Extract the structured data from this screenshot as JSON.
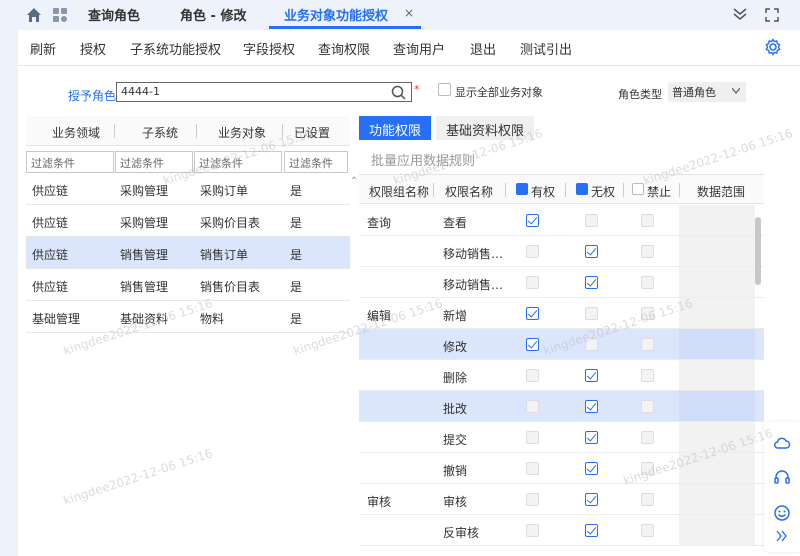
{
  "tabs": [
    {
      "label": "查询角色"
    },
    {
      "label": "角色 - 修改"
    },
    {
      "label": "业务对象功能授权",
      "close": "×"
    }
  ],
  "toolbar": [
    "刷新",
    "授权",
    "子系统功能授权",
    "字段授权",
    "查询权限",
    "查询用户",
    "退出",
    "测试引出"
  ],
  "form": {
    "role_label": "授予角色",
    "role_value": "4444-1",
    "required_mark": "*",
    "show_all_label": "显示全部业务对象",
    "role_type_label": "角色类型",
    "role_type_value": "普通角色"
  },
  "left_table": {
    "headers": [
      "业务领域",
      "子系统",
      "业务对象",
      "已设置"
    ],
    "filter_placeholder": "过滤条件",
    "rows": [
      [
        "供应链",
        "采购管理",
        "采购订单",
        "是"
      ],
      [
        "供应链",
        "采购管理",
        "采购价目表",
        "是"
      ],
      [
        "供应链",
        "销售管理",
        "销售订单",
        "是"
      ],
      [
        "供应链",
        "销售管理",
        "销售价目表",
        "是"
      ],
      [
        "基础管理",
        "基础资料",
        "物料",
        "是"
      ]
    ],
    "selected_row": 2
  },
  "right_panel": {
    "tabs": [
      "功能权限",
      "基础资料权限"
    ],
    "batch_label": "批量应用数据规则",
    "headers": [
      "权限组名称",
      "权限名称",
      "有权",
      "无权",
      "禁止",
      "数据范围"
    ],
    "rows": [
      {
        "group": "查询",
        "perm": "查看",
        "has": true,
        "none": false,
        "forbid": false
      },
      {
        "group": "",
        "perm": "移动销售…",
        "has": false,
        "none": true,
        "forbid": false
      },
      {
        "group": "",
        "perm": "移动销售…",
        "has": false,
        "none": true,
        "forbid": false
      },
      {
        "group": "编辑",
        "perm": "新增",
        "has": true,
        "none": false,
        "forbid": false
      },
      {
        "group": "",
        "perm": "修改",
        "has": true,
        "none": false,
        "forbid": false
      },
      {
        "group": "",
        "perm": "删除",
        "has": false,
        "none": true,
        "forbid": false
      },
      {
        "group": "",
        "perm": "批改",
        "has": false,
        "none": true,
        "forbid": false
      },
      {
        "group": "",
        "perm": "提交",
        "has": false,
        "none": true,
        "forbid": false
      },
      {
        "group": "",
        "perm": "撤销",
        "has": false,
        "none": true,
        "forbid": false
      },
      {
        "group": "审核",
        "perm": "审核",
        "has": false,
        "none": true,
        "forbid": false
      },
      {
        "group": "",
        "perm": "反审核",
        "has": false,
        "none": true,
        "forbid": false
      }
    ],
    "selected_rows": [
      4,
      6
    ]
  },
  "watermark": "kingdee2022-12-06 15:16",
  "colors": {
    "accent": "#276ff5",
    "selected_row": "#dbe5fc"
  }
}
